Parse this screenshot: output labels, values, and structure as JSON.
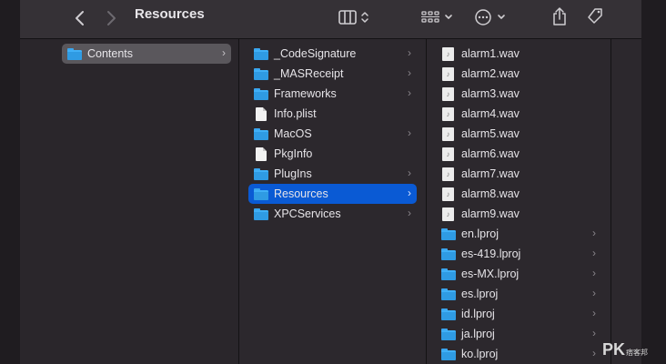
{
  "window": {
    "title": "Resources"
  },
  "toolbar": {
    "back_icon": "chevron-left-icon",
    "forward_icon": "chevron-right-icon",
    "view_icon": "column-view-icon",
    "group_icon": "grid-group-icon",
    "action_icon": "ellipsis-circle-icon",
    "share_icon": "share-icon",
    "tag_icon": "tag-icon"
  },
  "column1": {
    "items": [
      {
        "label": "Contents",
        "kind": "folder",
        "state": "inactive-selected",
        "has_children": true
      }
    ]
  },
  "column2": {
    "items": [
      {
        "label": "_CodeSignature",
        "kind": "folder",
        "has_children": true
      },
      {
        "label": "_MASReceipt",
        "kind": "folder",
        "has_children": true
      },
      {
        "label": "Frameworks",
        "kind": "folder",
        "has_children": true
      },
      {
        "label": "Info.plist",
        "kind": "file",
        "has_children": false
      },
      {
        "label": "MacOS",
        "kind": "folder",
        "has_children": true
      },
      {
        "label": "PkgInfo",
        "kind": "file",
        "has_children": false
      },
      {
        "label": "PlugIns",
        "kind": "folder",
        "has_children": true
      },
      {
        "label": "Resources",
        "kind": "folder",
        "state": "selected",
        "has_children": true
      },
      {
        "label": "XPCServices",
        "kind": "folder",
        "has_children": true
      }
    ]
  },
  "column3": {
    "items": [
      {
        "label": "alarm1.wav",
        "kind": "audio"
      },
      {
        "label": "alarm2.wav",
        "kind": "audio"
      },
      {
        "label": "alarm3.wav",
        "kind": "audio"
      },
      {
        "label": "alarm4.wav",
        "kind": "audio"
      },
      {
        "label": "alarm5.wav",
        "kind": "audio"
      },
      {
        "label": "alarm6.wav",
        "kind": "audio"
      },
      {
        "label": "alarm7.wav",
        "kind": "audio"
      },
      {
        "label": "alarm8.wav",
        "kind": "audio"
      },
      {
        "label": "alarm9.wav",
        "kind": "audio"
      },
      {
        "label": "en.lproj",
        "kind": "folder",
        "has_children": true
      },
      {
        "label": "es-419.lproj",
        "kind": "folder",
        "has_children": true
      },
      {
        "label": "es-MX.lproj",
        "kind": "folder",
        "has_children": true
      },
      {
        "label": "es.lproj",
        "kind": "folder",
        "has_children": true
      },
      {
        "label": "id.lproj",
        "kind": "folder",
        "has_children": true
      },
      {
        "label": "ja.lproj",
        "kind": "folder",
        "has_children": true
      },
      {
        "label": "ko.lproj",
        "kind": "folder",
        "has_children": true
      }
    ]
  },
  "colors": {
    "selection": "#0a5ad4",
    "folder": "#40b0f7",
    "background": "#2c282d"
  }
}
